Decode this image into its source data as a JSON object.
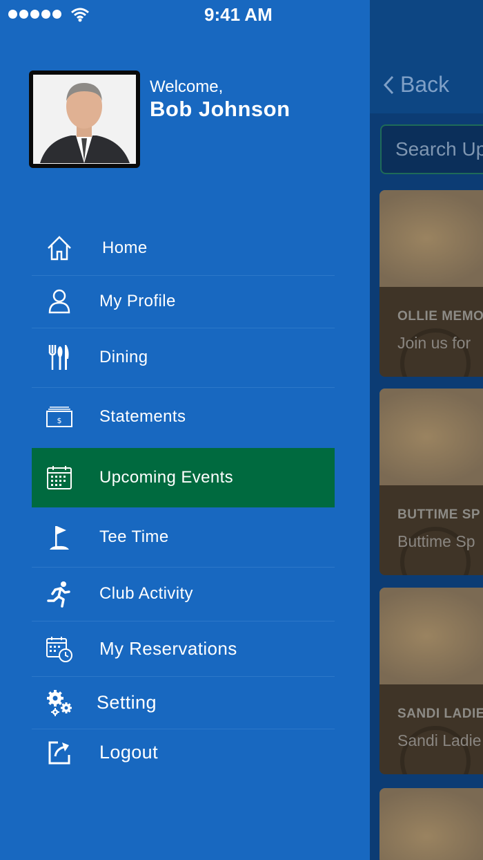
{
  "status_bar": {
    "time": "9:41 AM",
    "signal_icon": "signal-dots-icon",
    "wifi_icon": "wifi-icon"
  },
  "colors": {
    "drawer_bg": "#1868c0",
    "active_bg": "#006a3f",
    "text": "#ffffff"
  },
  "profile": {
    "welcome": "Welcome,",
    "name": "Bob Johnson"
  },
  "menu": {
    "items": [
      {
        "label": "Home",
        "icon": "home-icon"
      },
      {
        "label": "My Profile",
        "icon": "user-icon"
      },
      {
        "label": "Dining",
        "icon": "cutlery-icon"
      },
      {
        "label": "Statements",
        "icon": "statement-icon"
      },
      {
        "label": "Upcoming Events",
        "icon": "calendar-icon",
        "active": true
      },
      {
        "label": "Tee Time",
        "icon": "golf-flag-icon"
      },
      {
        "label": "Club Activity",
        "icon": "running-icon"
      },
      {
        "label": "My Reservations",
        "icon": "calendar-clock-icon"
      },
      {
        "label": "Setting",
        "icon": "gears-icon"
      },
      {
        "label": "Logout",
        "icon": "logout-icon"
      }
    ]
  },
  "background": {
    "back_label": "Back",
    "search_placeholder": "Search Up",
    "cards": [
      {
        "title": "OLLIE MEMO",
        "text": "Join us for"
      },
      {
        "title": "BUTTIME SP",
        "text": "Buttime Sp"
      },
      {
        "title": "SANDI LADIE",
        "text": "Sandi Ladie"
      }
    ]
  }
}
